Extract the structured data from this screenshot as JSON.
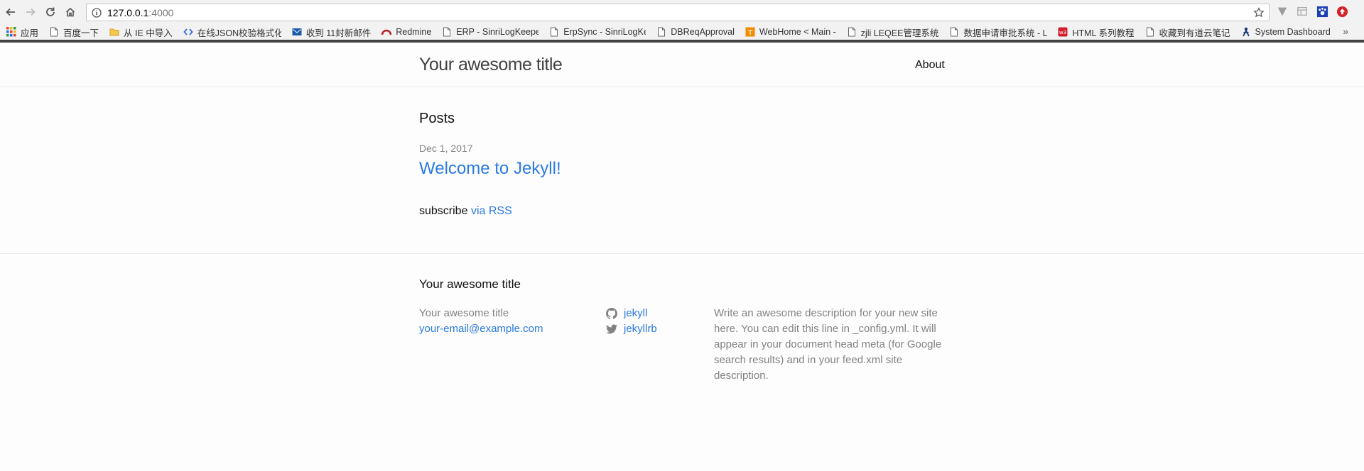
{
  "browser": {
    "url_host": "127.0.0.1",
    "url_port": ":4000",
    "bookmarks": [
      {
        "label": "应用",
        "icon": "apps-grid-icon"
      },
      {
        "label": "百度一下",
        "icon": "page-icon"
      },
      {
        "label": "从 IE 中导入",
        "icon": "folder-icon"
      },
      {
        "label": "在线JSON校验格式化",
        "icon": "code-icon"
      },
      {
        "label": "收到 11封新邮件",
        "icon": "mail-icon"
      },
      {
        "label": "Redmine",
        "icon": "redmine-icon"
      },
      {
        "label": "ERP - SinriLogKeeper",
        "icon": "page-icon"
      },
      {
        "label": "ErpSync - SinriLogKe",
        "icon": "page-icon"
      },
      {
        "label": "DBReqApproval",
        "icon": "page-icon"
      },
      {
        "label": "WebHome < Main -",
        "icon": "wiki-icon"
      },
      {
        "label": "zjli LEQEE管理系统",
        "icon": "page-icon"
      },
      {
        "label": "数据申请审批系统 - L",
        "icon": "page-icon"
      },
      {
        "label": "HTML 系列教程",
        "icon": "w3-icon"
      },
      {
        "label": "收藏到有道云笔记",
        "icon": "page-icon"
      },
      {
        "label": "System Dashboard",
        "icon": "jira-icon"
      }
    ],
    "more_glyph": "»",
    "colors": {
      "w3": "#d0202b",
      "redmine": "#b32024",
      "mail": "#1a5ca8",
      "ext_blue": "#1a3fb3",
      "ext_red": "#d2232a"
    }
  },
  "header": {
    "site_title": "Your awesome title",
    "nav": [
      {
        "label": "About"
      }
    ]
  },
  "main": {
    "posts_heading": "Posts",
    "posts": [
      {
        "date": "Dec 1, 2017",
        "title": "Welcome to Jekyll!"
      }
    ],
    "subscribe_text": "subscribe",
    "rss_link": "via RSS"
  },
  "footer": {
    "heading": "Your awesome title",
    "name": "Your awesome title",
    "email": "your-email@example.com",
    "github": "jekyll",
    "twitter": "jekyllrb",
    "description": "Write an awesome description for your new site here. You can edit this line in _config.yml. It will appear in your document head meta (for Google search results) and in your feed.xml site description."
  },
  "colors": {
    "link": "#2a7ae2",
    "muted": "#828282",
    "text": "#111111"
  }
}
